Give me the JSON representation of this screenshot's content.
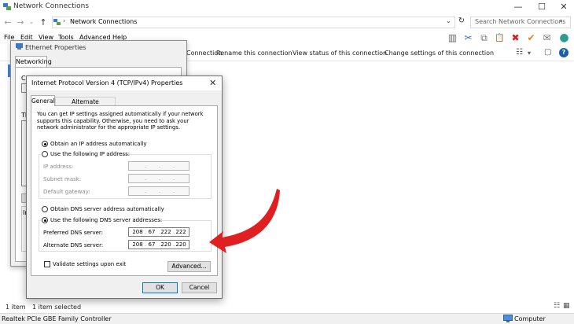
{
  "window": {
    "title": "Network Connections",
    "controls": {
      "minimize": "—",
      "maximize": "☐",
      "close": "✕"
    }
  },
  "address_bar": {
    "back": "←",
    "forward": "→",
    "recent": "⌄",
    "up": "↑",
    "separator": "›",
    "path": "Network Connections",
    "dropdown": "⌄",
    "refresh": "↻",
    "search_placeholder": "Search Network Connections",
    "search_glyph": "⌕"
  },
  "menu": {
    "items": [
      "File",
      "Edit",
      "View",
      "Tools",
      "Advanced",
      "Help"
    ]
  },
  "command_bar": {
    "items": [
      "Connection",
      "Rename this connection",
      "View status of this connection",
      "Change settings of this connection"
    ],
    "help": "?",
    "view_glyph": "☷",
    "view_dropdown": "▾",
    "pane_glyph": "▢"
  },
  "toolbar_icons": [
    {
      "name": "layout-icon",
      "glyph": "▥",
      "color": "#666666"
    },
    {
      "name": "cut-icon",
      "glyph": "✂",
      "color": "#3a6ea5"
    },
    {
      "name": "copy-icon",
      "glyph": "⧉",
      "color": "#777777"
    },
    {
      "name": "paste-icon",
      "glyph": "📋",
      "color": "#777777"
    },
    {
      "name": "delete-icon",
      "glyph": "✖",
      "color": "#d11a1a"
    },
    {
      "name": "checkmark-icon",
      "glyph": "✔",
      "color": "#e0821a"
    },
    {
      "name": "mail-icon",
      "glyph": "✉",
      "color": "#777777"
    },
    {
      "name": "globe-icon",
      "glyph": "●",
      "color": "#2a9d8f"
    }
  ],
  "status_bar": {
    "count": "1 item",
    "selected": "1 item selected",
    "details_glyph": "☷",
    "tiles_glyph": "▦"
  },
  "taskbar": {
    "adapter": "Realtek PCIe GBE Family Controller",
    "computer": "Computer"
  },
  "ethernet_dialog": {
    "title": "Ethernet Properties",
    "tab": "Networking",
    "fragments": [
      "Co",
      "Th",
      "In"
    ]
  },
  "ipv4_dialog": {
    "title": "Internet Protocol Version 4 (TCP/IPv4) Properties",
    "close": "✕",
    "tabs": {
      "general": "General",
      "alternate": "Alternate Configuration"
    },
    "intro": "You can get IP settings assigned automatically if your network supports this capability. Otherwise, you need to ask your network administrator for the appropriate IP settings.",
    "ip_options": {
      "auto": "Obtain an IP address automatically",
      "manual": "Use the following IP address:"
    },
    "ip_fields": {
      "ip_address": "IP address:",
      "subnet_mask": "Subnet mask:",
      "default_gateway": "Default gateway:"
    },
    "dns_options": {
      "auto": "Obtain DNS server address automatically",
      "manual": "Use the following DNS server addresses:"
    },
    "dns_fields": {
      "preferred_label": "Preferred DNS server:",
      "preferred": [
        "208",
        "67",
        "222",
        "222"
      ],
      "alternate_label": "Alternate DNS server:",
      "alternate": [
        "208",
        "67",
        "220",
        "220"
      ]
    },
    "validate": "Validate settings upon exit",
    "advanced": "Advanced...",
    "ok": "OK",
    "cancel": "Cancel"
  },
  "colors": {
    "accent": "#0078d7",
    "arrow": "#e02020"
  }
}
